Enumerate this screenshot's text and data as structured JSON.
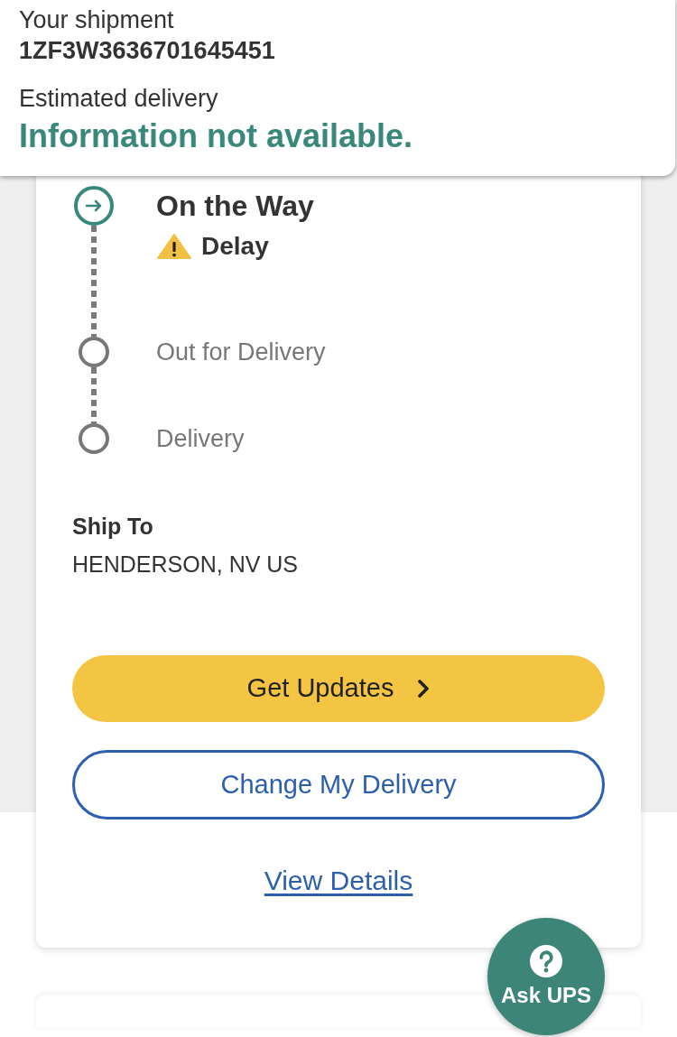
{
  "shipment_header": {
    "label": "Your shipment",
    "tracking_number": "1ZF3W3636701645451",
    "estimate_label": "Estimated delivery",
    "estimate_value": "Information not available."
  },
  "progress": {
    "steps": [
      {
        "label": "On the Way",
        "current": true,
        "alert": "Delay"
      },
      {
        "label": "Out for Delivery",
        "current": false
      },
      {
        "label": "Delivery",
        "current": false
      }
    ]
  },
  "ship_to": {
    "label": "Ship To",
    "address": "HENDERSON, NV US"
  },
  "actions": [
    {
      "kind": "primary",
      "label": "Get Updates"
    },
    {
      "kind": "outline",
      "label": "Change My Delivery"
    },
    {
      "kind": "link",
      "label": "View Details"
    }
  ],
  "help_button": {
    "label": "Ask UPS"
  }
}
